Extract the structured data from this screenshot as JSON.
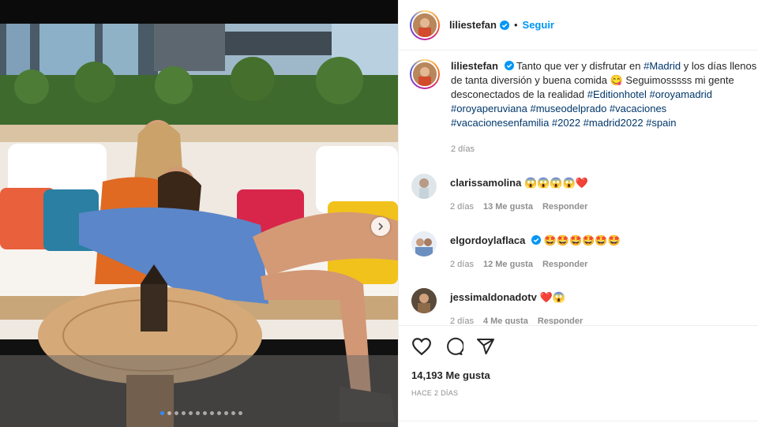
{
  "post": {
    "username": "liliestefan",
    "follow_label": "Seguir",
    "separator": "•",
    "caption": {
      "text_1": "Tanto que ver y disfrutar en ",
      "tag_madrid": "#Madrid",
      "text_2": " y los días llenos de tanta diversión y buena comida 😋 Seguimosssss mi gente desconectados de la realidad ",
      "tags": "#Editionhotel #oroyamadrid #oroyaperuviana #museodelprado #vacaciones #vacacionesenfamilia #2022 #madrid2022 #spain",
      "time": "2 días"
    }
  },
  "comments": [
    {
      "user": "clarissamolina",
      "text": "😱😱😱😱❤️",
      "time": "2 días",
      "likes": "13 Me gusta",
      "reply": "Responder"
    },
    {
      "user": "elgordoylaflaca",
      "text": "🤩🤩🤩🤩🤩🤩",
      "time": "2 días",
      "likes": "12 Me gusta",
      "reply": "Responder"
    },
    {
      "user": "jessimaldonadotv",
      "text": "❤️😱",
      "time": "2 días",
      "likes": "4 Me gusta",
      "reply": "Responder"
    }
  ],
  "footer": {
    "likes": "14,193 Me gusta",
    "posted": "HACE 2 DÍAS"
  },
  "colors": {
    "link": "#00376b",
    "follow": "#0095f6",
    "verified": "#0095f6"
  }
}
